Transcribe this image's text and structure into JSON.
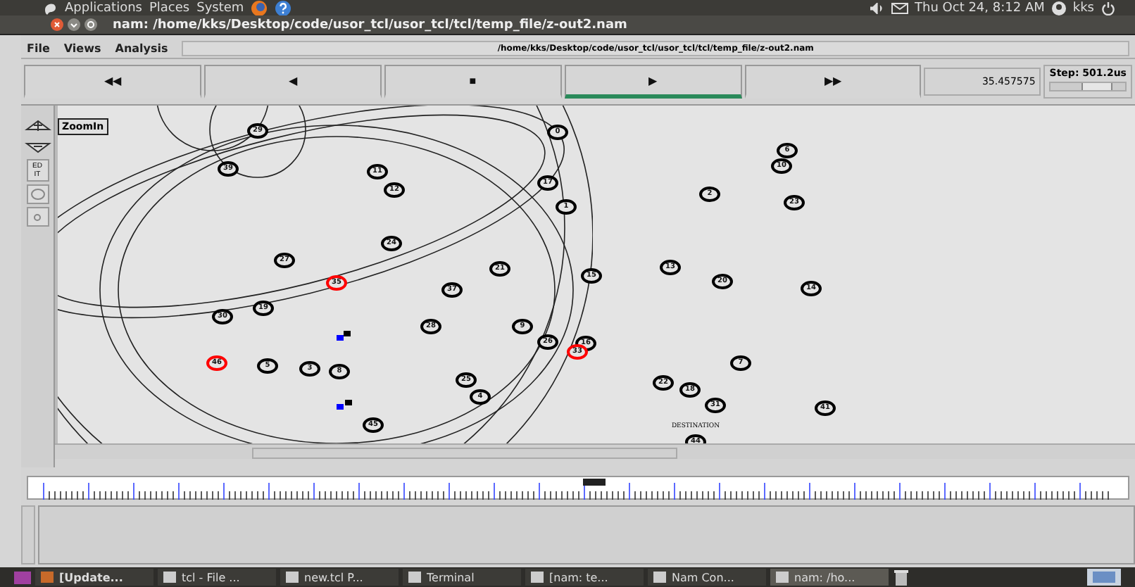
{
  "top_panel": {
    "menus": [
      "Applications",
      "Places",
      "System"
    ],
    "clock": "Thu Oct 24,  8:12 AM",
    "user": "kks"
  },
  "window": {
    "title": "nam: /home/kks/Desktop/code/usor_tcl/usor_tcl/tcl/temp_file/z-out2.nam"
  },
  "menu_bar": {
    "items": [
      "File",
      "Views",
      "Analysis"
    ],
    "file_path": "/home/kks/Desktop/code/usor_tcl/usor_tcl/tcl/temp_file/z-out2.nam"
  },
  "playback": {
    "buttons": [
      {
        "label": "◀◀",
        "selected": false
      },
      {
        "label": "◀",
        "selected": false
      },
      {
        "label": "■",
        "selected": false
      },
      {
        "label": "▶",
        "selected": true
      },
      {
        "label": "▶▶",
        "selected": false
      }
    ],
    "time": "35.457575",
    "step": "Step: 501.2us",
    "step_slider": {
      "level": 0.6
    }
  },
  "timeline": {
    "level": 0.515
  },
  "toolbar": {
    "edit_label": "EDIT",
    "tooltip": "ZoomIn"
  },
  "nodes": [
    {
      "label": "29",
      "color": "#000000"
    },
    {
      "label": "0",
      "color": "#000000"
    },
    {
      "label": "6",
      "color": "#000000"
    },
    {
      "label": "10",
      "color": "#000000"
    },
    {
      "label": "39",
      "color": "#000000"
    },
    {
      "label": "11",
      "color": "#000000"
    },
    {
      "label": "17",
      "color": "#000000"
    },
    {
      "label": "12",
      "color": "#000000"
    },
    {
      "label": "2",
      "color": "#000000"
    },
    {
      "label": "1",
      "color": "#000000"
    },
    {
      "label": "23",
      "color": "#000000"
    },
    {
      "label": "24",
      "color": "#000000"
    },
    {
      "label": "27",
      "color": "#000000"
    },
    {
      "label": "21",
      "color": "#000000"
    },
    {
      "label": "13",
      "color": "#000000"
    },
    {
      "label": "15",
      "color": "#000000"
    },
    {
      "label": "20",
      "color": "#000000"
    },
    {
      "label": "14",
      "color": "#000000"
    },
    {
      "label": "35",
      "color": "#ff0000"
    },
    {
      "label": "37",
      "color": "#000000"
    },
    {
      "label": "19",
      "color": "#000000"
    },
    {
      "label": "30",
      "color": "#000000"
    },
    {
      "label": "28",
      "color": "#000000"
    },
    {
      "label": "9",
      "color": "#000000"
    },
    {
      "label": "26",
      "color": "#000000"
    },
    {
      "label": "16",
      "color": "#000000"
    },
    {
      "label": "33",
      "color": "#ff0000"
    },
    {
      "label": "46",
      "color": "#ff0000"
    },
    {
      "label": "5",
      "color": "#000000"
    },
    {
      "label": "3",
      "color": "#000000"
    },
    {
      "label": "8",
      "color": "#000000"
    },
    {
      "label": "7",
      "color": "#000000"
    },
    {
      "label": "25",
      "color": "#000000"
    },
    {
      "label": "22",
      "color": "#000000"
    },
    {
      "label": "18",
      "color": "#000000"
    },
    {
      "label": "4",
      "color": "#000000"
    },
    {
      "label": "31",
      "color": "#000000"
    },
    {
      "label": "41",
      "color": "#000000"
    },
    {
      "label": "45",
      "color": "#000000"
    },
    {
      "label": "44",
      "color": "#000000",
      "caption": "DESTINATION"
    }
  ],
  "taskbar": [
    {
      "label": "[Update...",
      "selected": false
    },
    {
      "label": "tcl - File ...",
      "selected": false
    },
    {
      "label": "new.tcl P...",
      "selected": false
    },
    {
      "label": "Terminal",
      "selected": false
    },
    {
      "label": "[nam: te...",
      "selected": false
    },
    {
      "label": "Nam Con...",
      "selected": false
    },
    {
      "label": "nam: /ho...",
      "selected": true
    }
  ]
}
